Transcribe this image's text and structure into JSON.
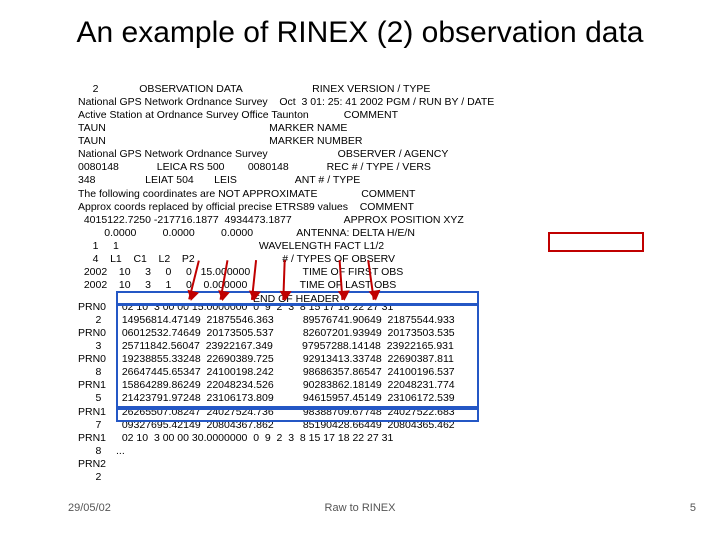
{
  "title": "An example of RINEX (2) observation data",
  "rinex_header": "     2              OBSERVATION DATA                        RINEX VERSION / TYPE\nNational GPS Network Ordnance Survey    Oct  3 01: 25: 41 2002 PGM / RUN BY / DATE\nActive Station at Ordnance Survey Office Taunton            COMMENT\nTAUN                                                        MARKER NAME\nTAUN                                                        MARKER NUMBER\nNational GPS Network Ordnance Survey                        OBSERVER / AGENCY\n0080148             LEICA RS 500        0080148             REC # / TYPE / VERS\n348                 LEIAT 504       LEIS                    ANT # / TYPE\nThe following coordinates are NOT APPROXIMATE               COMMENT\nApprox coords replaced by official precise ETRS89 values    COMMENT\n  4015122.7250 -217716.1877  4934473.1877                  APPROX POSITION XYZ\n         0.0000         0.0000         0.0000               ANTENNA: DELTA H/E/N\n     1     1                                                WAVELENGTH FACT L1/2\n     4    L1    C1    L2    P2                              # / TYPES OF OBSERV\n  2002    10     3     0     0   15.000000                  TIME OF FIRST OBS\n  2002    10     3     1     0    0.000000                  TIME OF LAST OBS\n                                                            END OF HEADER",
  "prn_labels": "PRN0\n      2\nPRN0\n      3\nPRN0\n      8\nPRN1\n      5\nPRN1\n      7\nPRN1\n      8\nPRN2\n      2",
  "data_block": "  02 10  3 00 00 15.0000000  0  9  2  3  8 15 17 18 22 27 31\n  14956814.47149  21875546.363          89576741.90649  21875544.933\n  06012532.74649  20173505.537          82607201.93949  20173503.535\n  25711842.56047  23922167.349          97957288.14148  23922165.931\n  19238855.33248  22690389.725          92913413.33748  22690387.811\n  26647445.65347  24100198.242          98686357.86547  24100196.537\n  15864289.86249  22048234.526          90283862.18149  22048231.774\n  21423791.97248  23106173.809          94615957.45149  23106172.539\n  26265507.08247  24027524.736          98388709.67748  24027522.683\n  09327695.42149  20804367.862          85190428.66449  20804365.462\n  02 10  3 00 00 30.0000000  0  9  2  3  8 15 17 18 22 27 31\n...",
  "footer": {
    "date": "29/05/02",
    "center": "Raw to RINEX",
    "page": "5"
  }
}
